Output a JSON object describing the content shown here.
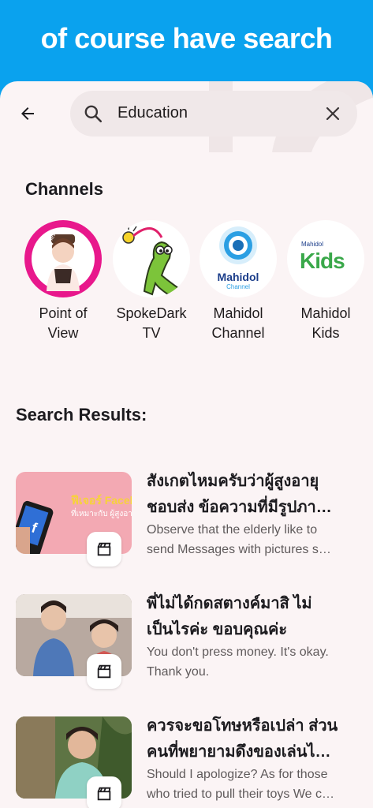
{
  "banner": {
    "title": "of course have search"
  },
  "search": {
    "query": "Education"
  },
  "channels": {
    "title": "Channels",
    "items": [
      {
        "line1": "Point of",
        "line2": "View",
        "badge_text": "Point of View"
      },
      {
        "line1": "SpokeDark",
        "line2": "TV"
      },
      {
        "line1": "Mahidol",
        "line2": "Channel",
        "logo_text": "Mahidol",
        "logo_sub": "Channel"
      },
      {
        "line1": "Mahidol",
        "line2": "Kids",
        "logo_text": "Kids",
        "logo_sub": "Mahidol"
      }
    ]
  },
  "results": {
    "title": "Search Results:",
    "items": [
      {
        "title1": "สังเกตไหมครับว่าผู้สูงอายุ",
        "title2": "ชอบส่ง ข้อความที่มีรูปภา…",
        "desc1": "Observe that the elderly like to",
        "desc2": "send Messages with pictures s…",
        "thumb_text": "ฟีเจอร์ Facebook",
        "thumb_sub": "ที่เหมาะกับ ผู้สูงอายุ"
      },
      {
        "title1": "พี่ไม่ได้กดสตางค์มาสิ ไม่",
        "title2": "เป็นไรค่ะ ขอบคุณค่ะ",
        "desc1": "You don't press money. It's okay.",
        "desc2": "Thank you."
      },
      {
        "title1": "ควรจะขอโทษหรือเปล่า ส่วน",
        "title2": "คนที่พยายามดึงของเล่นไ…",
        "desc1": "Should I apologize? As for those",
        "desc2": "who tried to pull their toys We c…"
      }
    ]
  },
  "colors": {
    "banner": "#0aa2ee",
    "background": "#fbf4f5",
    "search_field": "#f0e8e9"
  }
}
